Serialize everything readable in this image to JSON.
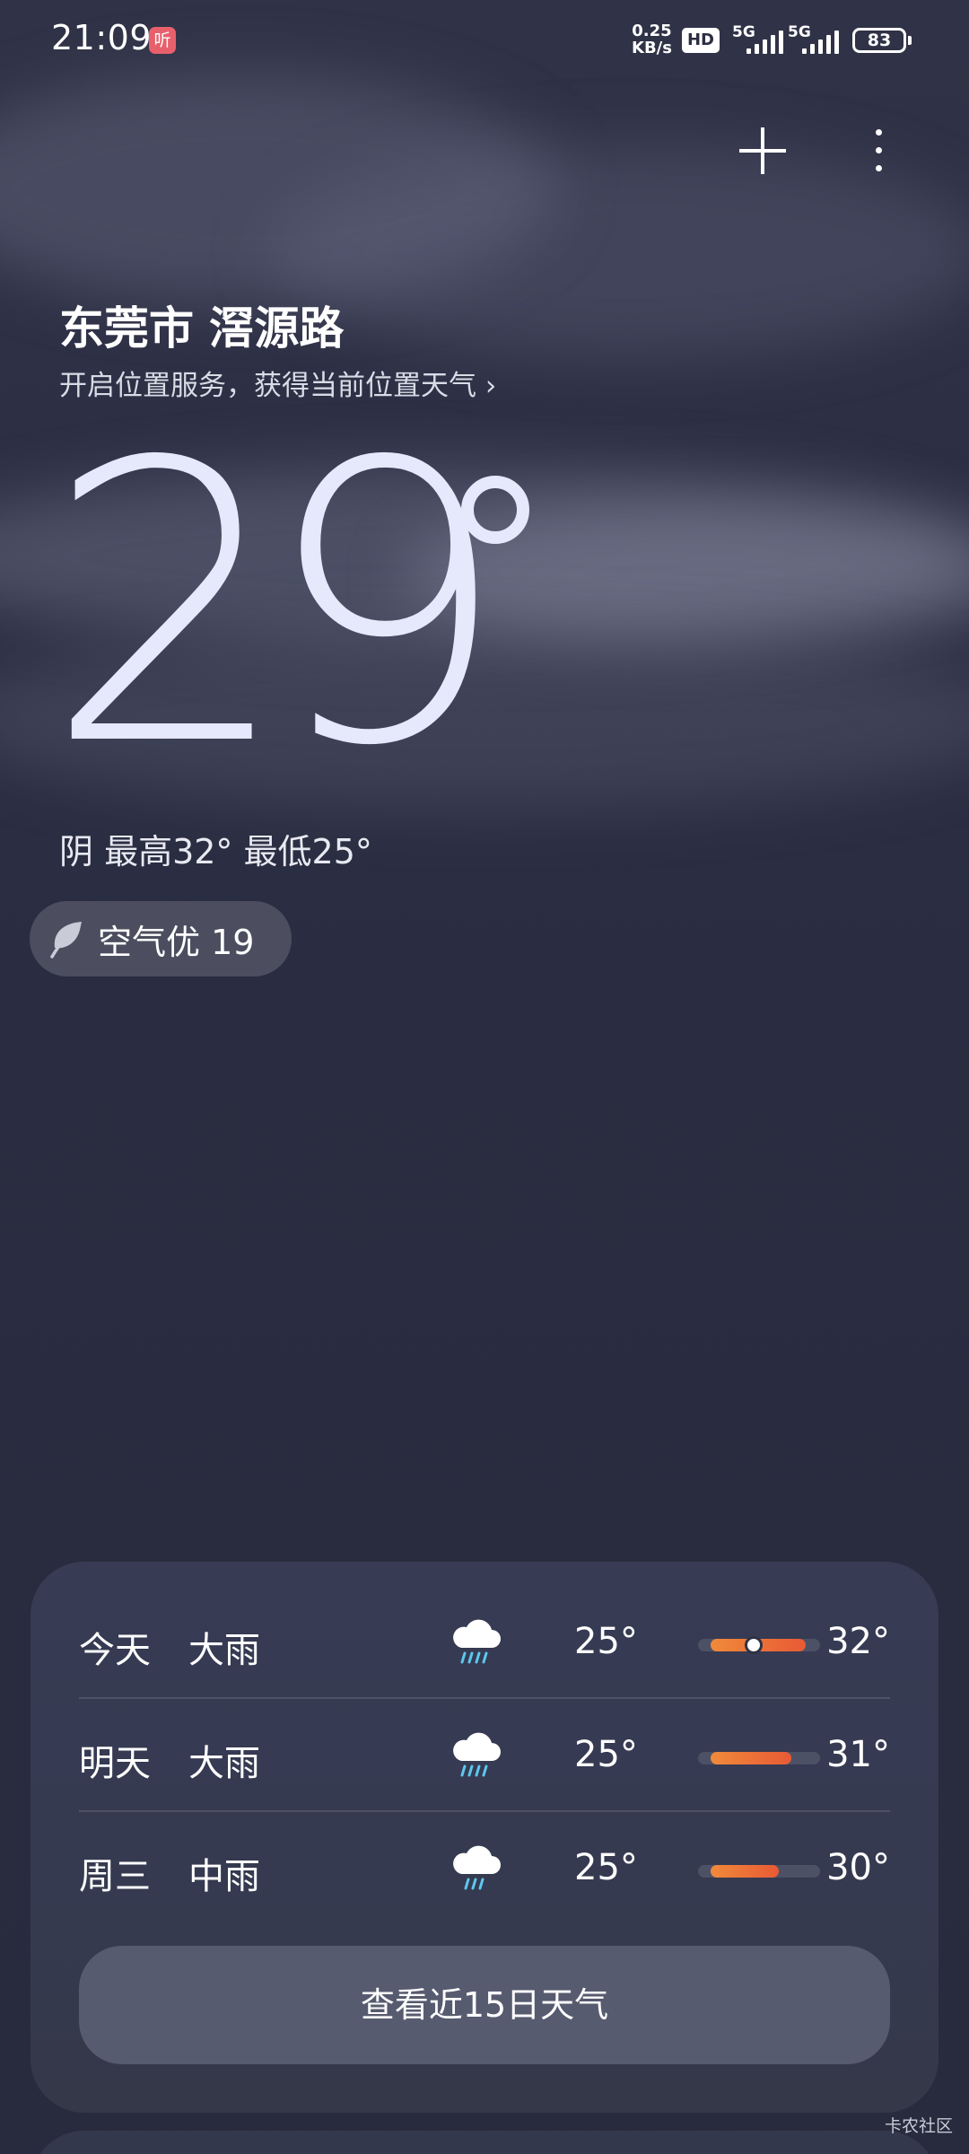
{
  "status_bar": {
    "time": "21:09",
    "notification_glyph": "听",
    "net_speed_value": "0.25",
    "net_speed_unit": "KB/s",
    "hd_badge": "HD",
    "signal1_label": "5G",
    "signal2_label": "5G",
    "battery": "83"
  },
  "header": {
    "add_city_icon": "plus-icon",
    "more_icon": "more-vert-icon"
  },
  "location": {
    "city": "东莞市 滘源路",
    "hint": "开启位置服务，获得当前位置天气 ›"
  },
  "current": {
    "temperature": "29",
    "condition_line": "阴  最高32° 最低25°"
  },
  "air_quality": {
    "label": "空气优 19",
    "icon": "leaf-icon"
  },
  "forecast": {
    "rows": [
      {
        "day": "今天",
        "weather": "大雨",
        "icon": "heavy-rain-icon",
        "low": "25°",
        "high": "32°"
      },
      {
        "day": "明天",
        "weather": "大雨",
        "icon": "heavy-rain-icon",
        "low": "25°",
        "high": "31°"
      },
      {
        "day": "周三",
        "weather": "中雨",
        "icon": "moderate-rain-icon",
        "low": "25°",
        "high": "30°"
      }
    ],
    "button_label": "查看近15日天气"
  },
  "watermark": "卡农社区",
  "colors": {
    "temp_bar_start": "#f08a3a",
    "temp_bar_end": "#e85a35",
    "rain_drop": "#5cc8f0"
  }
}
